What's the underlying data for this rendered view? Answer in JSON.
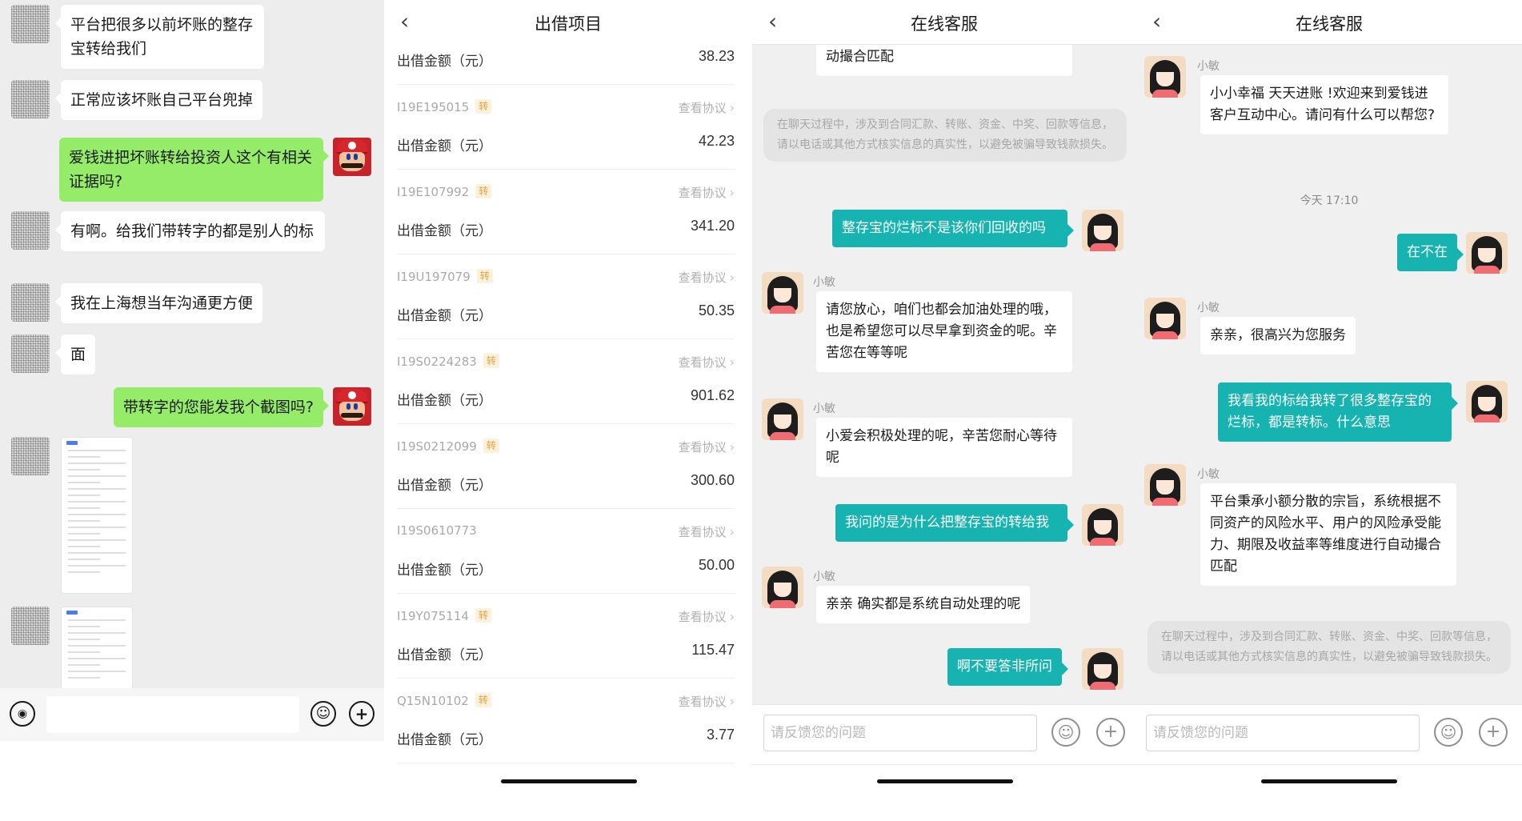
{
  "panel_wechat": {
    "messages": [
      {
        "side": "left",
        "text": "平台把很多以前坏账的整存宝转给我们"
      },
      {
        "side": "left",
        "text": "正常应该坏账自己平台兜掉"
      },
      {
        "side": "right",
        "text": "爱钱进把坏账转给投资人这个有相关证据吗?"
      },
      {
        "side": "left",
        "text": "有啊。给我们带转字的都是别人的标"
      },
      {
        "side": "left",
        "text": "我在上海想当年沟通更方便"
      },
      {
        "side": "left",
        "text": "面"
      },
      {
        "side": "right",
        "text": "带转字的您能发我个截图吗?"
      }
    ],
    "voice_icon": "voice-icon",
    "emoji_icon": "emoji-icon",
    "add_icon": "plus-icon",
    "colors": {
      "self_bubble": "#95ec69",
      "chat_bg": "#ededed"
    }
  },
  "panel_list": {
    "title": "出借项目",
    "back_icon": "chevron-left-icon",
    "amount_label": "出借金额（元）",
    "agreement_label": "查看协议",
    "transfer_badge": "转",
    "first_amount": "38.23",
    "items": [
      {
        "code": "I19E195015",
        "transfer": true,
        "amount": "42.23"
      },
      {
        "code": "I19E107992",
        "transfer": true,
        "amount": "341.20"
      },
      {
        "code": "I19U197079",
        "transfer": true,
        "amount": "50.35"
      },
      {
        "code": "I19S0224283",
        "transfer": true,
        "amount": "901.62"
      },
      {
        "code": "I19S0212099",
        "transfer": true,
        "amount": "300.60"
      },
      {
        "code": "I19S0610773",
        "transfer": false,
        "amount": "50.00"
      },
      {
        "code": "I19Y075114",
        "transfer": true,
        "amount": "115.47"
      },
      {
        "code": "Q15N10102",
        "transfer": true,
        "amount": "3.77"
      }
    ],
    "colors": {
      "badge": "#e9a23b"
    }
  },
  "panel_service_a": {
    "title": "在线客服",
    "agent_name": "小敏",
    "top_partial": "动撮合匹配",
    "system_note": "在聊天过程中，涉及到合同汇款、转账、资金、中奖、回款等信息，请以电话或其他方式核实信息的真实性，以避免被骗导致钱款损失。",
    "messages": [
      {
        "side": "right",
        "text": "整存宝的烂标不是该你们回收的吗"
      },
      {
        "side": "left",
        "text": "请您放心，咱们也都会加油处理的哦，也是希望您可以尽早拿到资金的呢。辛苦您在等等呢"
      },
      {
        "side": "left",
        "text": "小爱会积极处理的呢，辛苦您耐心等待呢"
      },
      {
        "side": "right",
        "text": "我问的是为什么把整存宝的转给我"
      },
      {
        "side": "left",
        "text": "亲亲 确实都是系统自动处理的呢"
      },
      {
        "side": "right",
        "text": "啊不要答非所问"
      }
    ],
    "input_placeholder": "请反馈您的问题",
    "colors": {
      "self_bubble": "#17b3b1"
    }
  },
  "panel_service_b": {
    "title": "在线客服",
    "agent_name": "小敏",
    "timestamp": "今天 17:10",
    "messages": [
      {
        "side": "left",
        "text": "小小幸福 天天进账 !欢迎来到爱钱进客户互动中心。请问有什么可以帮您?"
      },
      {
        "side": "right",
        "text": "在不在"
      },
      {
        "side": "left",
        "text": "亲亲，很高兴为您服务"
      },
      {
        "side": "right",
        "text": "我看我的标给我转了很多整存宝的烂标，都是转标。什么意思"
      },
      {
        "side": "left",
        "text": "平台秉承小额分散的宗旨，系统根据不同资产的风险水平、用户的风险承受能力、期限及收益率等维度进行自动撮合匹配"
      }
    ],
    "system_note": "在聊天过程中，涉及到合同汇款、转账、资金、中奖、回款等信息，请以电话或其他方式核实信息的真实性，以避免被骗导致钱款损失。",
    "input_placeholder": "请反馈您的问题"
  }
}
